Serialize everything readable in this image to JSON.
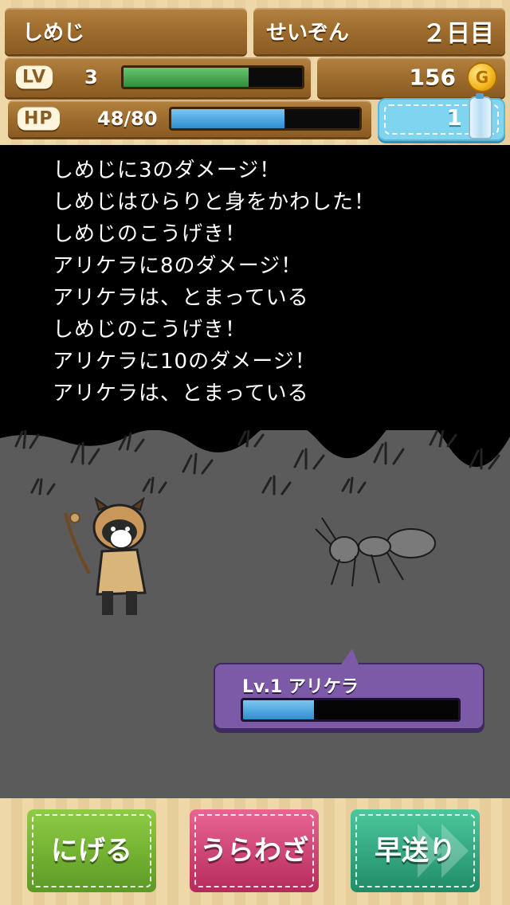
{
  "header": {
    "player_name": "しめじ",
    "mode": "せいぞん",
    "day": "２日目",
    "lv_tag": "LV",
    "level": "3",
    "gold": "156",
    "gold_icon": "G",
    "hp_tag": "HP",
    "hp_text": "48/80",
    "hp_fraction": 0.6,
    "exp_fraction": 0.7,
    "water": "1"
  },
  "log": [
    "しめじに3のダメージ！",
    "しめじはひらりと身をかわした！",
    "しめじのこうげき！",
    "アリケラに8のダメージ！",
    "アリケラは、とまっている",
    "しめじのこうげき！",
    "アリケラに10のダメージ！",
    "アリケラは、とまっている"
  ],
  "enemy": {
    "label": "Lv.1 アリケラ",
    "hp_fraction": 0.33
  },
  "commands": {
    "flee": "にげる",
    "special": "うらわざ",
    "fast_forward": "早送り"
  },
  "colors": {
    "exp_bar": "#3fa04b",
    "hp_bar": "#2f8ed0",
    "flee_button": "#7ab83a",
    "special_button": "#d8467a",
    "fast_forward_button": "#2fae86"
  }
}
